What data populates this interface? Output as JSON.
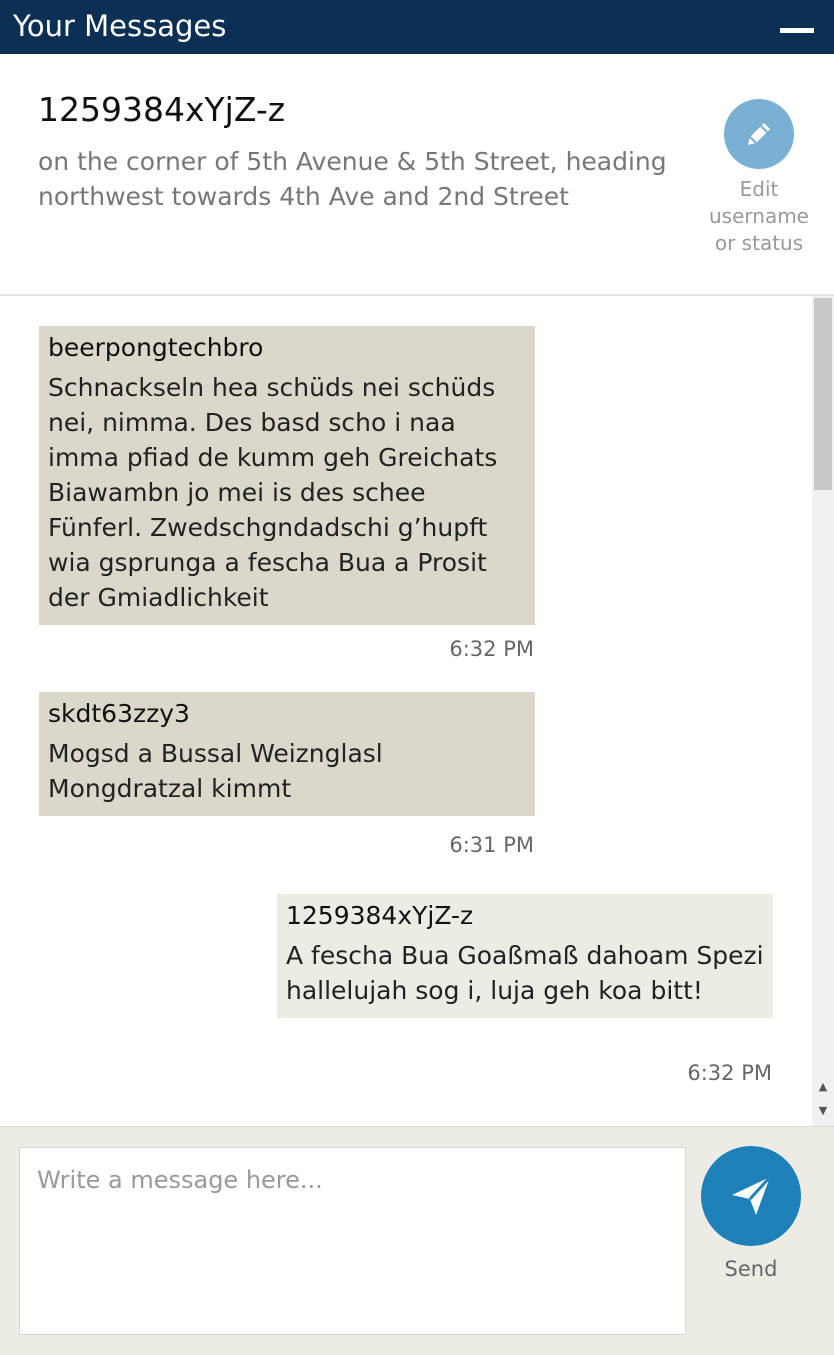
{
  "header": {
    "title": "Your Messages",
    "minimize_icon": "minus-icon"
  },
  "profile": {
    "username": "1259384xYjZ-z",
    "status": "on the corner of 5th Avenue & 5th Street, heading northwest towards 4th Ave and 2nd Street",
    "edit_label": "Edit username or status",
    "edit_icon": "pencil-icon",
    "accent_color": "#7ab0d4"
  },
  "messages": [
    {
      "author": "beerpongtechbro",
      "text": "Schnackseln hea schüds nei schüds nei, nimma. Des basd scho i naa imma pfiad de kumm geh Greichats Biawambn jo mei is des schee Fünferl. Zwedschgndadschi g’hupft wia gsprunga a fescha Bua a Prosit der Gmiadlichkeit",
      "time": "6:32 PM",
      "direction": "received"
    },
    {
      "author": "skdt63zzy3",
      "text": "Mogsd a Bussal Weiznglasl Mongdratzal kimmt",
      "time": "6:31 PM",
      "direction": "received"
    },
    {
      "author": "1259384xYjZ-z",
      "text": "A fescha Bua Goaßmaß dahoam Spezi hallelujah sog i, luja geh koa bitt!",
      "time": "6:32 PM",
      "direction": "sent"
    }
  ],
  "composer": {
    "placeholder": "Write a message here...",
    "value": "",
    "send_label": "Send",
    "send_icon": "paper-plane-icon",
    "accent_color": "#1e80b8"
  },
  "colors": {
    "header_bg": "#0c3054",
    "received_bubble": "#dbd7cb",
    "sent_bubble": "#ecebe4"
  }
}
